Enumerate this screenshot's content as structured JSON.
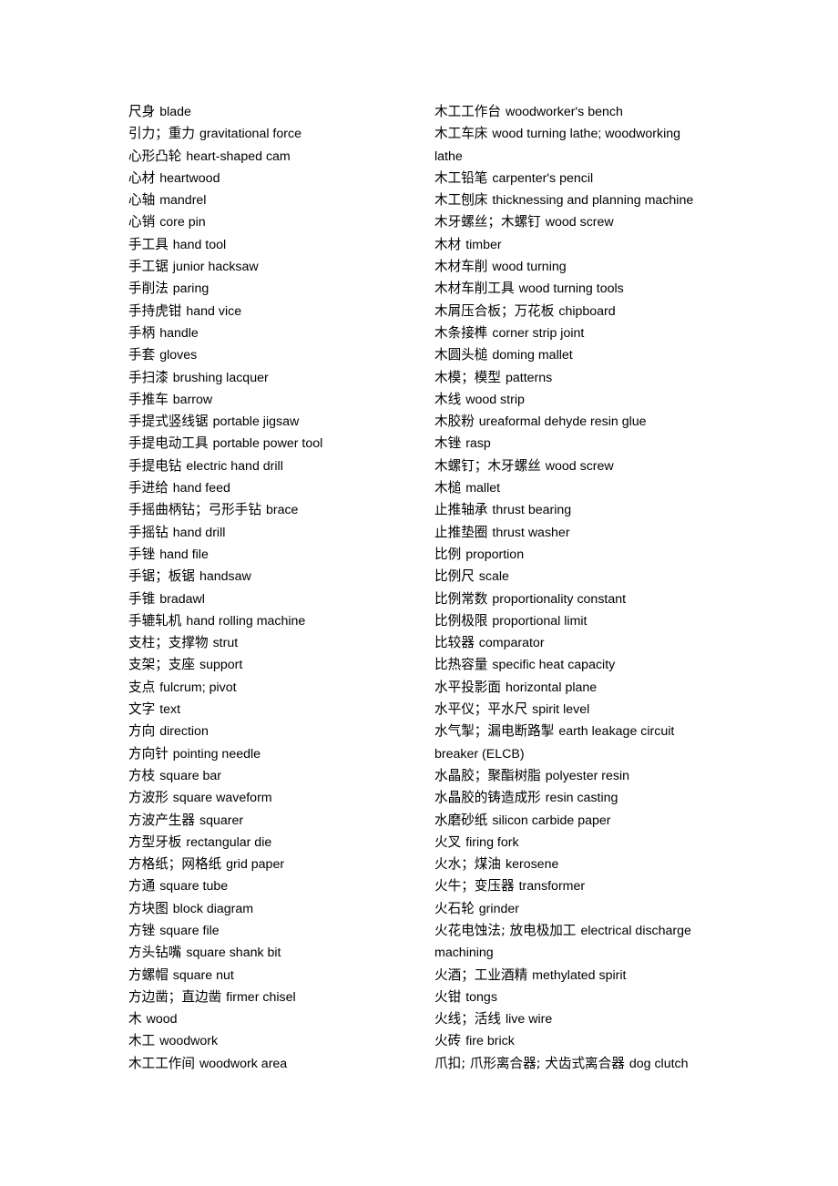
{
  "document": {
    "type": "bilingual-glossary",
    "language_pair": "Chinese-English",
    "columns": [
      {
        "name": "left-column",
        "entries": [
          {
            "term": "尺身",
            "gloss": "blade"
          },
          {
            "term": "引力；重力",
            "gloss": "gravitational force"
          },
          {
            "term": "心形凸轮",
            "gloss": "heart-shaped cam"
          },
          {
            "term": "心材",
            "gloss": "heartwood"
          },
          {
            "term": "心轴",
            "gloss": "mandrel"
          },
          {
            "term": "心销",
            "gloss": "core pin"
          },
          {
            "term": "手工具",
            "gloss": "hand tool"
          },
          {
            "term": "手工锯",
            "gloss": "junior hacksaw"
          },
          {
            "term": "手削法",
            "gloss": "paring"
          },
          {
            "term": "手持虎钳",
            "gloss": "hand vice"
          },
          {
            "term": "手柄",
            "gloss": "handle"
          },
          {
            "term": "手套",
            "gloss": "gloves"
          },
          {
            "term": "手扫漆",
            "gloss": "brushing lacquer"
          },
          {
            "term": "手推车",
            "gloss": "barrow"
          },
          {
            "term": "手提式竖线锯",
            "gloss": "portable jigsaw"
          },
          {
            "term": "手提电动工具",
            "gloss": "portable power tool"
          },
          {
            "term": "手提电钻",
            "gloss": "electric hand drill"
          },
          {
            "term": "手进给",
            "gloss": "hand feed"
          },
          {
            "term": "手摇曲柄钻；弓形手钻",
            "gloss": "brace"
          },
          {
            "term": "手摇钻",
            "gloss": "hand drill"
          },
          {
            "term": "手锉",
            "gloss": "hand file"
          },
          {
            "term": "手锯；板锯",
            "gloss": "handsaw"
          },
          {
            "term": "手锥",
            "gloss": "bradawl"
          },
          {
            "term": "手辘轧机",
            "gloss": "hand rolling machine"
          },
          {
            "term": "支柱；支撑物",
            "gloss": "strut"
          },
          {
            "term": "支架；支座",
            "gloss": "support"
          },
          {
            "term": "支点",
            "gloss": "fulcrum; pivot"
          },
          {
            "term": "文字",
            "gloss": "text"
          },
          {
            "term": "方向",
            "gloss": "direction"
          },
          {
            "term": "方向针",
            "gloss": "pointing needle"
          },
          {
            "term": "方枝",
            "gloss": "square bar"
          },
          {
            "term": "方波形",
            "gloss": "square waveform"
          },
          {
            "term": "方波产生器",
            "gloss": "squarer"
          },
          {
            "term": "方型牙板",
            "gloss": "rectangular die"
          },
          {
            "term": "方格纸；网格纸",
            "gloss": "grid paper"
          },
          {
            "term": "方通",
            "gloss": "square tube"
          },
          {
            "term": "方块图",
            "gloss": "block diagram"
          },
          {
            "term": "方锉",
            "gloss": "square file"
          },
          {
            "term": "方头钻嘴",
            "gloss": "square shank bit"
          },
          {
            "term": "方螺帽",
            "gloss": "square nut"
          },
          {
            "term": "方边凿；直边凿",
            "gloss": "firmer chisel"
          },
          {
            "term": "木",
            "gloss": "wood"
          },
          {
            "term": "木工",
            "gloss": "woodwork"
          },
          {
            "term": "木工工作间",
            "gloss": "woodwork area"
          }
        ]
      },
      {
        "name": "right-column",
        "entries": [
          {
            "term": "木工工作台",
            "gloss": "woodworker's bench"
          },
          {
            "term": "木工车床",
            "gloss": "wood turning lathe; woodworking lathe"
          },
          {
            "term": "木工铅笔",
            "gloss": "carpenter's pencil"
          },
          {
            "term": "木工刨床",
            "gloss": "thicknessing and planning machine"
          },
          {
            "term": "木牙螺丝；木螺钉",
            "gloss": "wood screw"
          },
          {
            "term": "木材",
            "gloss": "timber"
          },
          {
            "term": "木材车削",
            "gloss": "wood turning"
          },
          {
            "term": "木材车削工具",
            "gloss": "wood turning tools"
          },
          {
            "term": "木屑压合板；万花板",
            "gloss": "chipboard"
          },
          {
            "term": "木条接榫",
            "gloss": "corner strip joint"
          },
          {
            "term": "木圆头槌",
            "gloss": "doming mallet"
          },
          {
            "term": "木模；模型",
            "gloss": "patterns"
          },
          {
            "term": "木线",
            "gloss": "wood strip"
          },
          {
            "term": "木胶粉",
            "gloss": "ureaformal dehyde resin glue"
          },
          {
            "term": "木锉",
            "gloss": "rasp"
          },
          {
            "term": "木螺钉；木牙螺丝",
            "gloss": "wood screw"
          },
          {
            "term": "木槌",
            "gloss": "mallet"
          },
          {
            "term": "止推轴承",
            "gloss": "thrust bearing"
          },
          {
            "term": "止推垫圈",
            "gloss": "thrust washer"
          },
          {
            "term": "比例",
            "gloss": "proportion"
          },
          {
            "term": "比例尺",
            "gloss": "scale"
          },
          {
            "term": "比例常数",
            "gloss": "proportionality constant"
          },
          {
            "term": "比例极限",
            "gloss": "proportional limit"
          },
          {
            "term": "比较器",
            "gloss": "comparator"
          },
          {
            "term": "比热容量",
            "gloss": "specific heat capacity"
          },
          {
            "term": "水平投影面",
            "gloss": "horizontal plane"
          },
          {
            "term": "水平仪；平水尺",
            "gloss": "spirit level"
          },
          {
            "term": "水气掣；漏电断路掣",
            "gloss": "earth leakage circuit breaker (ELCB)"
          },
          {
            "term": "水晶胶；聚酯树脂",
            "gloss": "polyester resin"
          },
          {
            "term": "水晶胶的铸造成形",
            "gloss": "resin casting"
          },
          {
            "term": "水磨砂纸",
            "gloss": "silicon carbide paper"
          },
          {
            "term": "火叉",
            "gloss": "firing fork"
          },
          {
            "term": "火水；煤油",
            "gloss": "kerosene"
          },
          {
            "term": "火牛；变压器",
            "gloss": "transformer"
          },
          {
            "term": "火石轮",
            "gloss": "grinder"
          },
          {
            "term": "火花电蚀法; 放电极加工",
            "gloss": "electrical discharge machining"
          },
          {
            "term": "火酒；工业酒精",
            "gloss": "methylated spirit"
          },
          {
            "term": "火钳",
            "gloss": "tongs"
          },
          {
            "term": "火线；活线",
            "gloss": "live wire"
          },
          {
            "term": "火砖",
            "gloss": "fire brick"
          },
          {
            "term": "爪扣; 爪形离合器; 犬齿式离合器",
            "gloss": "dog clutch"
          }
        ]
      }
    ]
  }
}
